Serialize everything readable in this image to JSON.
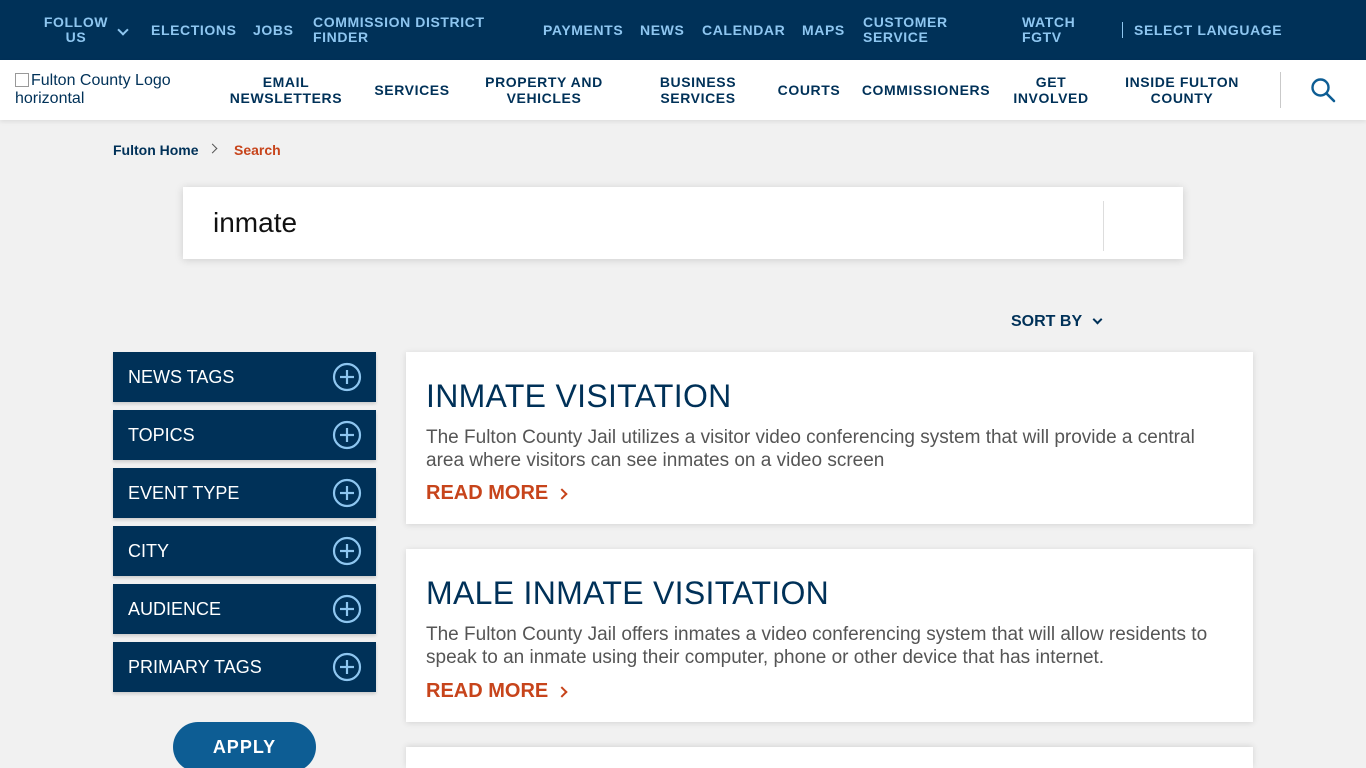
{
  "topbar": {
    "follow_us": "FOLLOW US",
    "elections": "ELECTIONS",
    "jobs": "JOBS",
    "commission_district_finder": "COMMISSION DISTRICT FINDER",
    "payments": "PAYMENTS",
    "news": "NEWS",
    "calendar": "CALENDAR",
    "maps": "MAPS",
    "customer_service": "CUSTOMER SERVICE",
    "watch_fgtv": "WATCH FGTV",
    "select_language": "SELECT LANGUAGE"
  },
  "logo": {
    "alt_text": "Fulton County Logo horizontal"
  },
  "mainnav": {
    "email_newsletters": "EMAIL NEWSLETTERS",
    "services": "SERVICES",
    "property_and_vehicles": "PROPERTY AND VEHICLES",
    "business_services": "BUSINESS SERVICES",
    "courts": "COURTS",
    "commissioners": "COMMISSIONERS",
    "get_involved": "GET INVOLVED",
    "inside_fulton_county": "INSIDE FULTON COUNTY"
  },
  "breadcrumb": {
    "home": "Fulton Home",
    "current": "Search"
  },
  "search": {
    "value": "inmate"
  },
  "sort": {
    "label": "SORT BY"
  },
  "filters": [
    {
      "label": "NEWS TAGS"
    },
    {
      "label": "TOPICS"
    },
    {
      "label": "EVENT TYPE"
    },
    {
      "label": "CITY"
    },
    {
      "label": "AUDIENCE"
    },
    {
      "label": "PRIMARY TAGS"
    }
  ],
  "apply_label": "APPLY",
  "results": [
    {
      "title": "INMATE VISITATION",
      "description": "The Fulton County Jail utilizes a visitor video conferencing system that will provide a central area where visitors can see inmates on a video screen",
      "link_label": "READ MORE"
    },
    {
      "title": "MALE INMATE VISITATION",
      "description": "The Fulton County Jail offers inmates a video conferencing system that will allow residents to speak to an inmate using their computer, phone or other device that has internet.",
      "link_label": "READ MORE"
    }
  ],
  "colors": {
    "navy": "#003158",
    "accent_orange": "#c7441b",
    "topbar_link": "#8ec6f0",
    "apply_blue": "#0d5d94"
  }
}
